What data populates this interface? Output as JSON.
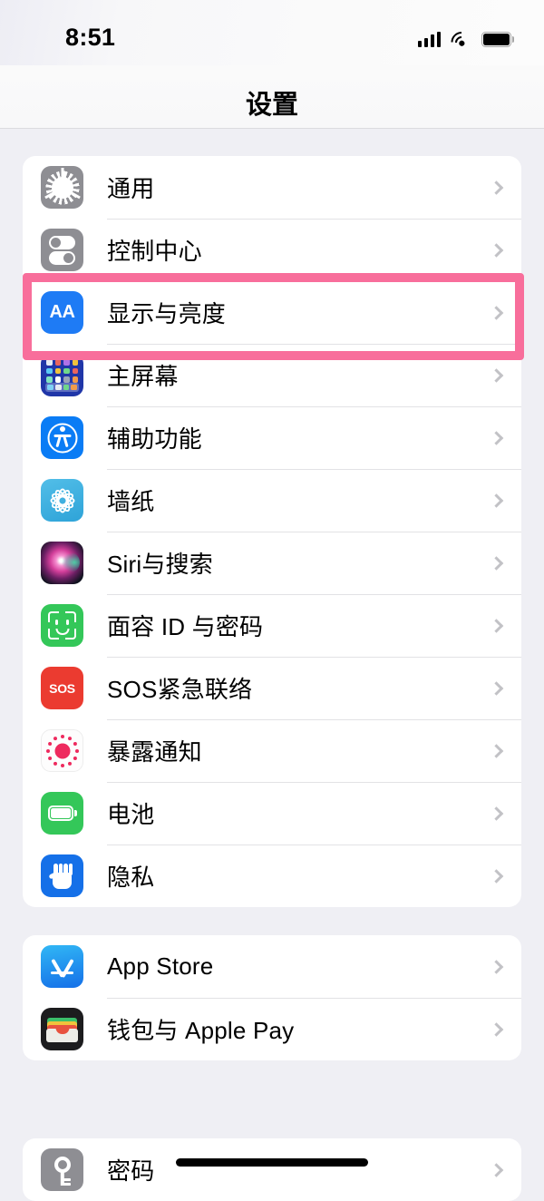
{
  "status_bar": {
    "time": "8:51",
    "cellular_icon": "signal-bars-icon",
    "wifi_icon": "wifi-icon",
    "battery_icon": "battery-full-icon"
  },
  "header": {
    "title": "设置"
  },
  "highlight": {
    "color": "#F86E9B",
    "target_row": "显示与亮度"
  },
  "groups": [
    {
      "id": "group-1",
      "rows": [
        {
          "label": "通用",
          "icon": "gear-icon",
          "icon_color": "#8E8E93",
          "chevron": "chevron-right-icon"
        },
        {
          "label": "控制中心",
          "icon": "control-center-icon",
          "icon_color": "#8E8E93",
          "chevron": "chevron-right-icon"
        },
        {
          "label": "显示与亮度",
          "icon": "display-brightness-icon",
          "icon_color": "#1E7BF5",
          "chevron": "chevron-right-icon"
        },
        {
          "label": "主屏幕",
          "icon": "home-screen-icon",
          "icon_color": "#2036A8",
          "chevron": "chevron-right-icon"
        },
        {
          "label": "辅助功能",
          "icon": "accessibility-icon",
          "icon_color": "#0A7CF5",
          "chevron": "chevron-right-icon"
        },
        {
          "label": "墙纸",
          "icon": "wallpaper-icon",
          "icon_color": "#2EA3D8",
          "chevron": "chevron-right-icon"
        },
        {
          "label": "Siri与搜索",
          "icon": "siri-icon",
          "icon_color": "#10131F",
          "chevron": "chevron-right-icon"
        },
        {
          "label": "面容 ID 与密码",
          "icon": "face-id-icon",
          "icon_color": "#34C759",
          "chevron": "chevron-right-icon"
        },
        {
          "label": "SOS紧急联络",
          "icon": "sos-icon",
          "icon_color": "#EB3B30",
          "chevron": "chevron-right-icon"
        },
        {
          "label": "暴露通知",
          "icon": "exposure-notification-icon",
          "icon_color": "#EE2A5E",
          "chevron": "chevron-right-icon"
        },
        {
          "label": "电池",
          "icon": "battery-icon",
          "icon_color": "#34C759",
          "chevron": "chevron-right-icon"
        },
        {
          "label": "隐私",
          "icon": "privacy-hand-icon",
          "icon_color": "#1570E8",
          "chevron": "chevron-right-icon"
        }
      ]
    },
    {
      "id": "group-2",
      "rows": [
        {
          "label": "App Store",
          "icon": "app-store-icon",
          "icon_color": "#1570E8",
          "chevron": "chevron-right-icon"
        },
        {
          "label": "钱包与 Apple Pay",
          "icon": "wallet-icon",
          "icon_color": "#1C1C1E",
          "chevron": "chevron-right-icon"
        }
      ]
    },
    {
      "id": "group-3",
      "rows": [
        {
          "label": "密码",
          "icon": "passwords-key-icon",
          "icon_color": "#8E8E93",
          "chevron": "chevron-right-icon"
        }
      ]
    }
  ],
  "home_indicator": "home-indicator"
}
